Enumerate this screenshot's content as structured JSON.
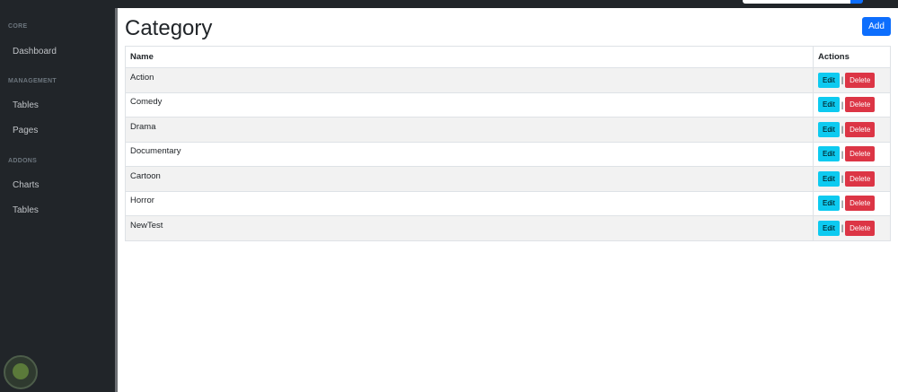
{
  "sidebar": {
    "sections": [
      {
        "heading": "Core",
        "items": [
          {
            "label": "Dashboard"
          }
        ]
      },
      {
        "heading": "Management",
        "items": [
          {
            "label": "Tables"
          },
          {
            "label": "Pages"
          }
        ]
      },
      {
        "heading": "Addons",
        "items": [
          {
            "label": "Charts"
          },
          {
            "label": "Tables"
          }
        ]
      }
    ]
  },
  "main": {
    "title": "Category",
    "add_label": "Add",
    "table": {
      "headers": {
        "name": "Name",
        "actions": "Actions"
      },
      "rows": [
        {
          "name": "Action"
        },
        {
          "name": "Comedy"
        },
        {
          "name": "Drama"
        },
        {
          "name": "Documentary"
        },
        {
          "name": "Cartoon"
        },
        {
          "name": "Horror"
        },
        {
          "name": "NewTest"
        }
      ],
      "edit_label": "Edit",
      "separator": "|",
      "delete_label": "Delete"
    }
  },
  "colors": {
    "sidebar_bg": "#212529",
    "add_button": "#0d6efd",
    "edit_button": "#0dcaf0",
    "delete_button": "#dc3545"
  }
}
